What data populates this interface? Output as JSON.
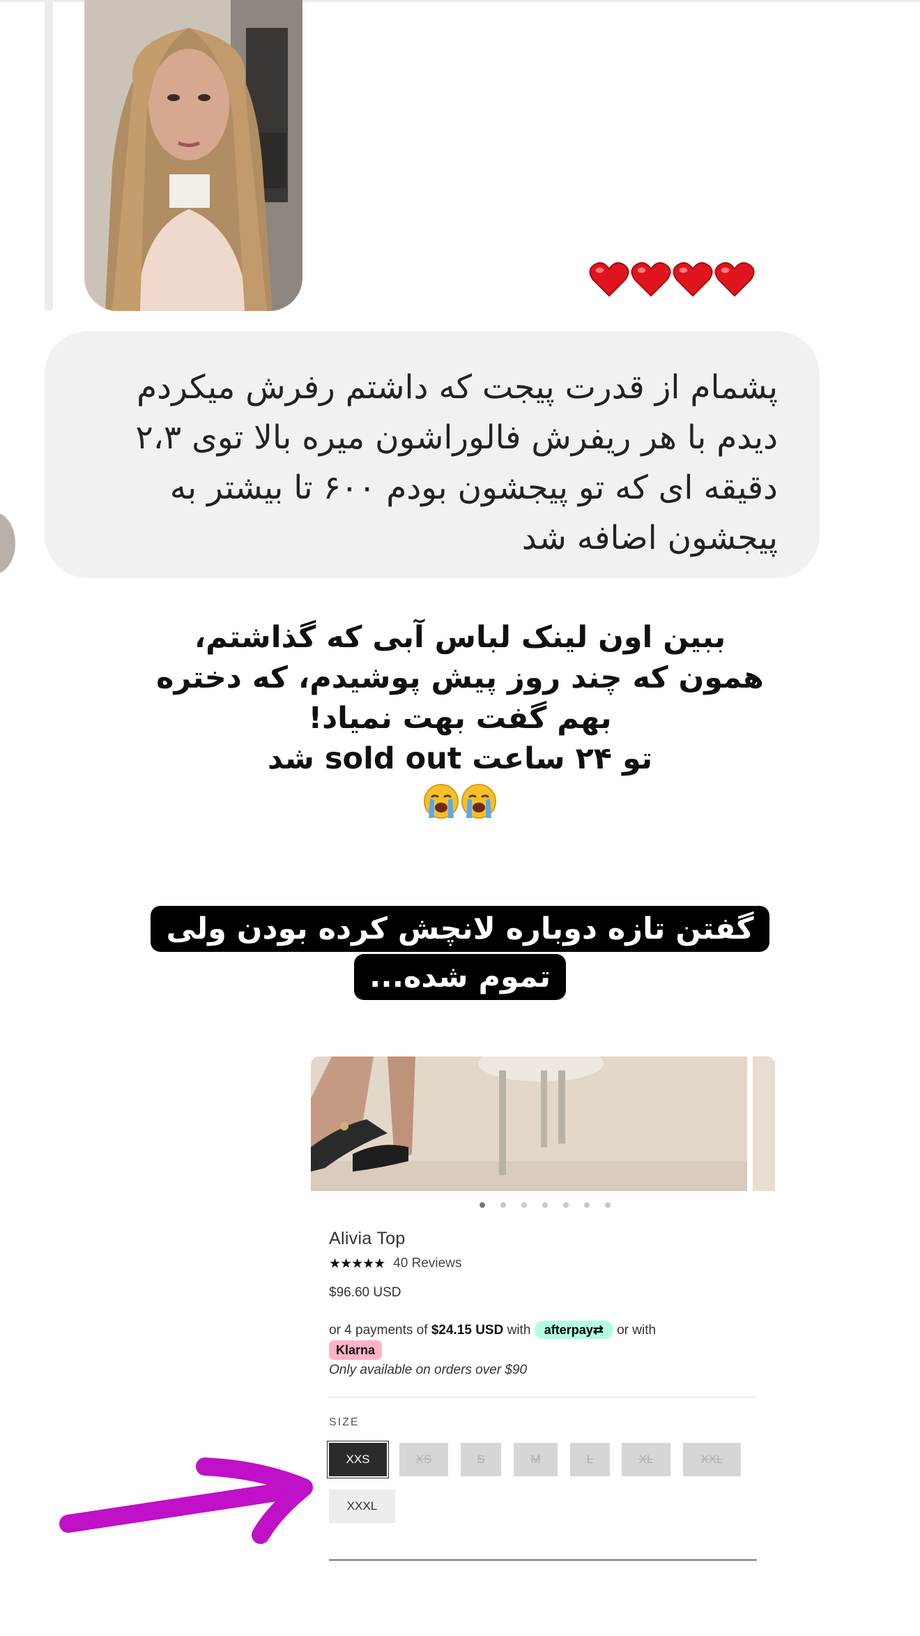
{
  "chat": {
    "reaction_hearts": [
      "heart",
      "heart",
      "heart",
      "heart"
    ],
    "message_lines": [
      "پشمام از قدرت پیجت که داشتم رفرش میکردم",
      "دیدم با هر ریفرش فالوراشون میره بالا توی ۲،۳",
      "دقیقه ای که تو پیجشون بودم ۶۰۰ تا بیشتر به",
      "پیجشون اضافه شد"
    ]
  },
  "caption": {
    "lines": [
      "ببین اون لینک لباس آبی که گذاشتم،",
      "همون که چند روز پیش پوشیدم، که دختره",
      "بهم گفت بهت نمیاد!",
      "تو ۲۴ ساعت sold out شد"
    ],
    "emojis": [
      "loudly-crying-face",
      "loudly-crying-face"
    ]
  },
  "banner": {
    "text": "گفتن تازه دوباره لانچش کرده بودن ولی تموم شده..."
  },
  "product": {
    "title": "Alivia Top",
    "stars": "★★★★★",
    "reviews": "40 Reviews",
    "price": "$96.60 USD",
    "installment_prefix": "or 4 payments of",
    "installment_amount": "$24.15 USD",
    "installment_with": "with",
    "afterpay": "afterpay⇄",
    "installment_or": "or with",
    "klarna": "Klarna",
    "note": "Only available on orders over $90",
    "carousel_dots": 7,
    "carousel_active_index": 0,
    "size_label": "SIZE",
    "sizes": [
      {
        "label": "XXS",
        "state": "selected"
      },
      {
        "label": "XS",
        "state": "sold-out"
      },
      {
        "label": "S",
        "state": "sold-out"
      },
      {
        "label": "M",
        "state": "sold-out"
      },
      {
        "label": "L",
        "state": "sold-out"
      },
      {
        "label": "XL",
        "state": "sold-out"
      },
      {
        "label": "XXL",
        "state": "sold-out"
      },
      {
        "label": "XXXL",
        "state": "available"
      }
    ]
  },
  "annotation": {
    "arrow_color": "#c010c8"
  },
  "colors": {
    "bubble_bg": "#f0f1f3",
    "banner_bg": "#000000",
    "selected_size": "#2b2b2b",
    "afterpay_bg": "#b2fce4",
    "klarna_bg": "#ffb3c7"
  }
}
